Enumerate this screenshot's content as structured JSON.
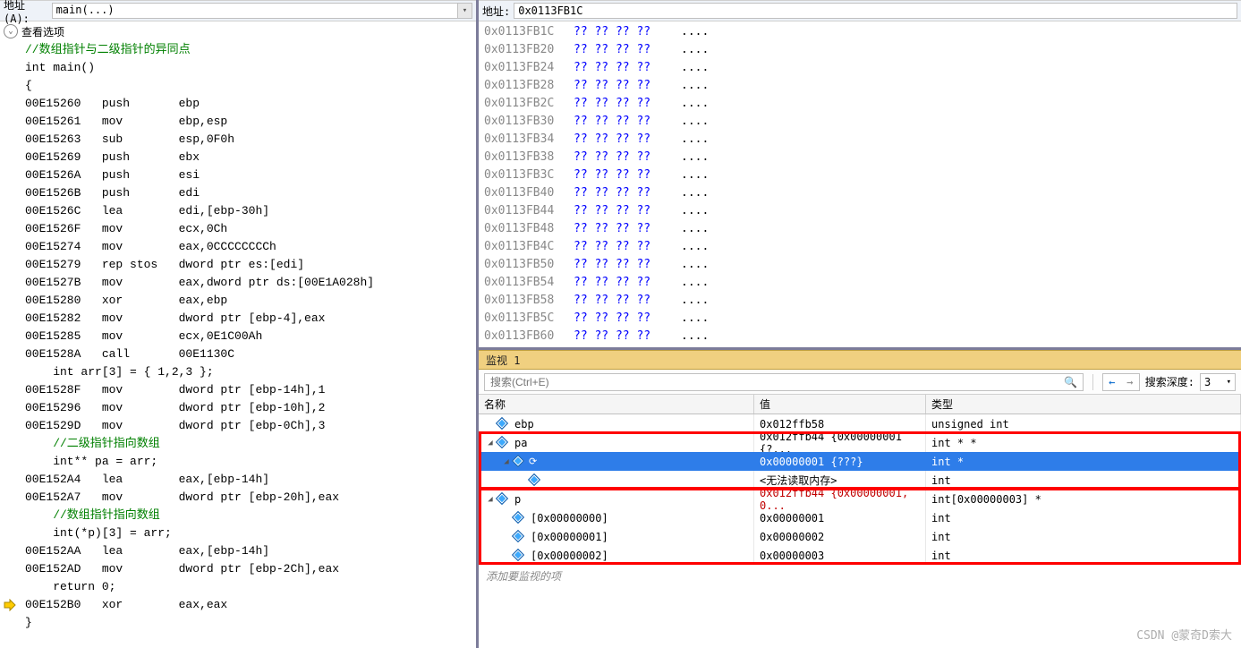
{
  "left": {
    "address_label": "地址(A):",
    "address_value": "main(...)",
    "view_options": "查看选项",
    "code": [
      {
        "t": "comment",
        "text": "//数组指针与二级指针的异同点"
      },
      {
        "t": "plain",
        "text": "int main()"
      },
      {
        "t": "plain",
        "text": "{"
      },
      {
        "t": "asm",
        "addr": "00E15260",
        "op": "push",
        "args": "ebp"
      },
      {
        "t": "asm",
        "addr": "00E15261",
        "op": "mov",
        "args": "ebp,esp"
      },
      {
        "t": "asm",
        "addr": "00E15263",
        "op": "sub",
        "args": "esp,0F0h"
      },
      {
        "t": "asm",
        "addr": "00E15269",
        "op": "push",
        "args": "ebx"
      },
      {
        "t": "asm",
        "addr": "00E1526A",
        "op": "push",
        "args": "esi"
      },
      {
        "t": "asm",
        "addr": "00E1526B",
        "op": "push",
        "args": "edi"
      },
      {
        "t": "asm",
        "addr": "00E1526C",
        "op": "lea",
        "args": "edi,[ebp-30h]"
      },
      {
        "t": "asm",
        "addr": "00E1526F",
        "op": "mov",
        "args": "ecx,0Ch"
      },
      {
        "t": "asm",
        "addr": "00E15274",
        "op": "mov",
        "args": "eax,0CCCCCCCCh"
      },
      {
        "t": "asm",
        "addr": "00E15279",
        "op": "rep stos",
        "args": "dword ptr es:[edi]"
      },
      {
        "t": "asm",
        "addr": "00E1527B",
        "op": "mov",
        "args": "eax,dword ptr ds:[00E1A028h]"
      },
      {
        "t": "asm",
        "addr": "00E15280",
        "op": "xor",
        "args": "eax,ebp"
      },
      {
        "t": "asm",
        "addr": "00E15282",
        "op": "mov",
        "args": "dword ptr [ebp-4],eax"
      },
      {
        "t": "asm",
        "addr": "00E15285",
        "op": "mov",
        "args": "ecx,0E1C00Ah"
      },
      {
        "t": "asm",
        "addr": "00E1528A",
        "op": "call",
        "args": "00E1130C"
      },
      {
        "t": "src",
        "text": "    int arr[3] = { 1,2,3 };"
      },
      {
        "t": "asm",
        "addr": "00E1528F",
        "op": "mov",
        "args": "dword ptr [ebp-14h],1"
      },
      {
        "t": "asm",
        "addr": "00E15296",
        "op": "mov",
        "args": "dword ptr [ebp-10h],2"
      },
      {
        "t": "asm",
        "addr": "00E1529D",
        "op": "mov",
        "args": "dword ptr [ebp-0Ch],3"
      },
      {
        "t": "comment",
        "text": "    //二级指针指向数组"
      },
      {
        "t": "src",
        "text": "    int** pa = arr;"
      },
      {
        "t": "asm",
        "addr": "00E152A4",
        "op": "lea",
        "args": "eax,[ebp-14h]"
      },
      {
        "t": "asm",
        "addr": "00E152A7",
        "op": "mov",
        "args": "dword ptr [ebp-20h],eax"
      },
      {
        "t": "comment",
        "text": "    //数组指针指向数组"
      },
      {
        "t": "src",
        "text": "    int(*p)[3] = arr;"
      },
      {
        "t": "asm",
        "addr": "00E152AA",
        "op": "lea",
        "args": "eax,[ebp-14h]"
      },
      {
        "t": "asm",
        "addr": "00E152AD",
        "op": "mov",
        "args": "dword ptr [ebp-2Ch],eax"
      },
      {
        "t": "src",
        "text": "    return 0;"
      },
      {
        "t": "asm",
        "addr": "00E152B0",
        "op": "xor",
        "args": "eax,eax",
        "current": true
      },
      {
        "t": "plain",
        "text": "}"
      }
    ]
  },
  "memory": {
    "address_label": "地址:",
    "address_value": "0x0113FB1C",
    "rows": [
      {
        "addr": "0x0113FB1C",
        "bytes": "?? ?? ?? ??",
        "ascii": "...."
      },
      {
        "addr": "0x0113FB20",
        "bytes": "?? ?? ?? ??",
        "ascii": "...."
      },
      {
        "addr": "0x0113FB24",
        "bytes": "?? ?? ?? ??",
        "ascii": "...."
      },
      {
        "addr": "0x0113FB28",
        "bytes": "?? ?? ?? ??",
        "ascii": "...."
      },
      {
        "addr": "0x0113FB2C",
        "bytes": "?? ?? ?? ??",
        "ascii": "...."
      },
      {
        "addr": "0x0113FB30",
        "bytes": "?? ?? ?? ??",
        "ascii": "...."
      },
      {
        "addr": "0x0113FB34",
        "bytes": "?? ?? ?? ??",
        "ascii": "...."
      },
      {
        "addr": "0x0113FB38",
        "bytes": "?? ?? ?? ??",
        "ascii": "...."
      },
      {
        "addr": "0x0113FB3C",
        "bytes": "?? ?? ?? ??",
        "ascii": "...."
      },
      {
        "addr": "0x0113FB40",
        "bytes": "?? ?? ?? ??",
        "ascii": "...."
      },
      {
        "addr": "0x0113FB44",
        "bytes": "?? ?? ?? ??",
        "ascii": "...."
      },
      {
        "addr": "0x0113FB48",
        "bytes": "?? ?? ?? ??",
        "ascii": "...."
      },
      {
        "addr": "0x0113FB4C",
        "bytes": "?? ?? ?? ??",
        "ascii": "...."
      },
      {
        "addr": "0x0113FB50",
        "bytes": "?? ?? ?? ??",
        "ascii": "...."
      },
      {
        "addr": "0x0113FB54",
        "bytes": "?? ?? ?? ??",
        "ascii": "...."
      },
      {
        "addr": "0x0113FB58",
        "bytes": "?? ?? ?? ??",
        "ascii": "...."
      },
      {
        "addr": "0x0113FB5C",
        "bytes": "?? ?? ?? ??",
        "ascii": "...."
      },
      {
        "addr": "0x0113FB60",
        "bytes": "?? ?? ?? ??",
        "ascii": "...."
      }
    ]
  },
  "watch": {
    "title": "监视 1",
    "search_placeholder": "搜索(Ctrl+E)",
    "depth_label": "搜索深度:",
    "depth_value": "3",
    "columns": {
      "name": "名称",
      "value": "值",
      "type": "类型"
    },
    "rows": [
      {
        "indent": 0,
        "exp": "",
        "icon": true,
        "name": "ebp",
        "value": "0x012ffb58",
        "type": "unsigned int",
        "box": false
      },
      {
        "indent": 0,
        "exp": "open",
        "icon": true,
        "name": "pa",
        "value": "0x012ffb44 {0x00000001 {?...",
        "type": "int * *",
        "box": true
      },
      {
        "indent": 1,
        "exp": "open",
        "icon": true,
        "refresh": true,
        "name": "",
        "value": "0x00000001 {???}",
        "type": "int *",
        "selected": true,
        "box": true
      },
      {
        "indent": 2,
        "exp": "",
        "icon": true,
        "name": "",
        "value": "<无法读取内存>",
        "type": "int",
        "box": true
      },
      {
        "indent": 0,
        "exp": "open",
        "icon": true,
        "name": "p",
        "value": "0x012ffb44 {0x00000001, 0...",
        "type": "int[0x00000003] *",
        "err": true,
        "box": true
      },
      {
        "indent": 1,
        "exp": "",
        "icon": true,
        "name": "[0x00000000]",
        "value": "0x00000001",
        "type": "int",
        "box": true
      },
      {
        "indent": 1,
        "exp": "",
        "icon": true,
        "name": "[0x00000001]",
        "value": "0x00000002",
        "type": "int",
        "box": true
      },
      {
        "indent": 1,
        "exp": "",
        "icon": true,
        "name": "[0x00000002]",
        "value": "0x00000003",
        "type": "int",
        "box": true
      }
    ],
    "add_item": "添加要监视的项"
  },
  "watermark": "CSDN @蒙奇D索大"
}
